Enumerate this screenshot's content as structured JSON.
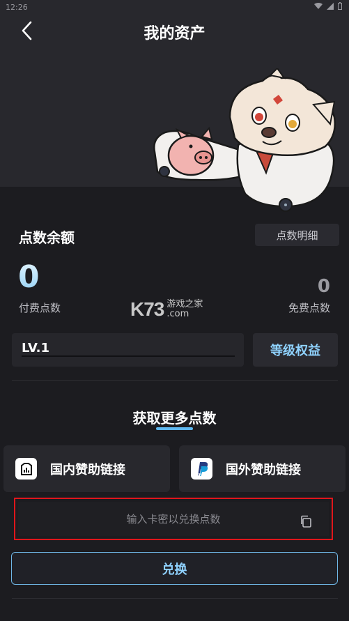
{
  "status_bar": {
    "time": "12:26"
  },
  "header": {
    "title": "我的资产"
  },
  "balance": {
    "section_label": "点数余额",
    "detail_button": "点数明细",
    "paid_points": "0",
    "paid_label": "付费点数",
    "free_points": "0",
    "free_label": "免费点数"
  },
  "watermark": {
    "logo": "K73",
    "line1": "游戏之家",
    "line2": ".com"
  },
  "level": {
    "label": "LV.1",
    "progress": 0.0,
    "benefits_button": "等级权益"
  },
  "earn_more": {
    "title": "获取更多点数",
    "domestic_label": "国内赞助链接",
    "overseas_label": "国外赞助链接",
    "overseas_icon_text": "PayPal"
  },
  "redeem": {
    "placeholder": "输入卡密以兑换点数",
    "button_label": "兑换"
  },
  "colors": {
    "accent": "#8fd2ff",
    "highlight_border": "#e0161b"
  }
}
